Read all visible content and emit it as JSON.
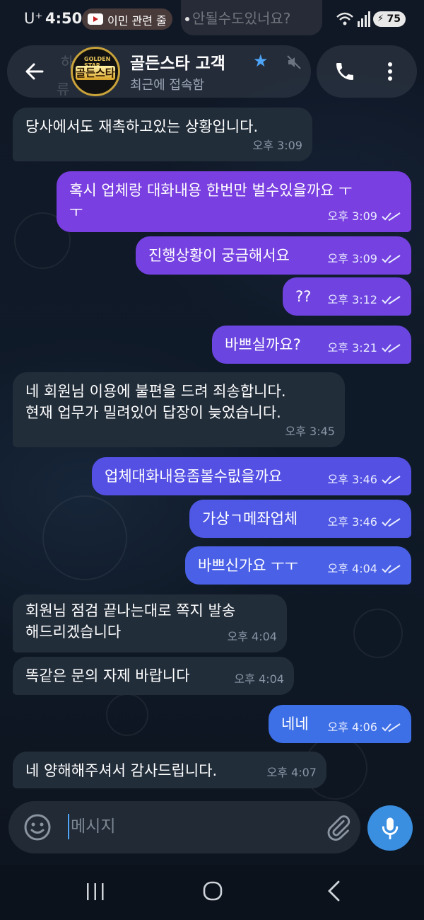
{
  "status_bar": {
    "carrier": "U⁺",
    "time": "4:50",
    "notification_pill": "이민 관련 줄",
    "notification_ghost": "안될수도있너요?",
    "battery": "75"
  },
  "header": {
    "title": "골든스타 고객",
    "status": "최근에 접속함",
    "avatar_top_text": "GOLDEN STAR",
    "avatar_main_text": "골든스타",
    "ghost_text_1": "하",
    "ghost_text_2": "류"
  },
  "messages": [
    {
      "direction": "in",
      "text": "당사에서도 재촉하고있는 상황입니다.",
      "time": "오후 3:09",
      "read": false
    },
    {
      "direction": "out",
      "text": "혹시 업체랑 대화내용 한번만 벌수있을까요 ㅜ\nㅜ",
      "time": "오후 3:09",
      "read": true
    },
    {
      "direction": "out",
      "text": "진행상황이 궁금해서요",
      "time": "오후 3:09",
      "read": true
    },
    {
      "direction": "out",
      "text": "??",
      "time": "오후 3:12",
      "read": true
    },
    {
      "direction": "out",
      "text": "바쁘실까요?",
      "time": "오후 3:21",
      "read": true
    },
    {
      "direction": "in",
      "text": "네 회원님 이용에 불편을 드려 죄송합니다.\n현재 업무가 밀려있어 답장이 늦었습니다.",
      "time": "오후 3:45",
      "read": false
    },
    {
      "direction": "out",
      "text": "업체대화내용좀볼수릾을까요",
      "time": "오후 3:46",
      "read": true
    },
    {
      "direction": "out",
      "text": "가상ㄱ메좌업체",
      "time": "오후 3:46",
      "read": true
    },
    {
      "direction": "out",
      "text": "바쁘신가요 ㅜㅜ",
      "time": "오후 4:04",
      "read": true
    },
    {
      "direction": "in",
      "text": "회원님 점검 끝나는대로 쪽지 발송\n해드리겠습니다",
      "time": "오후 4:04",
      "read": false
    },
    {
      "direction": "in",
      "text": "똑같은 문의 자제 바랍니다",
      "time": "오후 4:04",
      "read": false
    },
    {
      "direction": "out",
      "text": "네네",
      "time": "오후 4:06",
      "read": true
    },
    {
      "direction": "in",
      "text": "네 양해해주셔서 감사드립니다.",
      "time": "오후 4:07",
      "read": false
    }
  ],
  "composer": {
    "placeholder": "메시지"
  },
  "colors": {
    "background": "#0e1621",
    "incoming_bubble": "#222d3a",
    "outgoing_top": "#7a3fe0",
    "outgoing_bottom": "#3d6fe6",
    "accent": "#3b8fe0"
  },
  "icons": [
    "back-arrow-icon",
    "star-icon",
    "mute-icon",
    "phone-icon",
    "more-vertical-icon",
    "emoji-icon",
    "paperclip-icon",
    "microphone-icon",
    "double-check-icon"
  ]
}
